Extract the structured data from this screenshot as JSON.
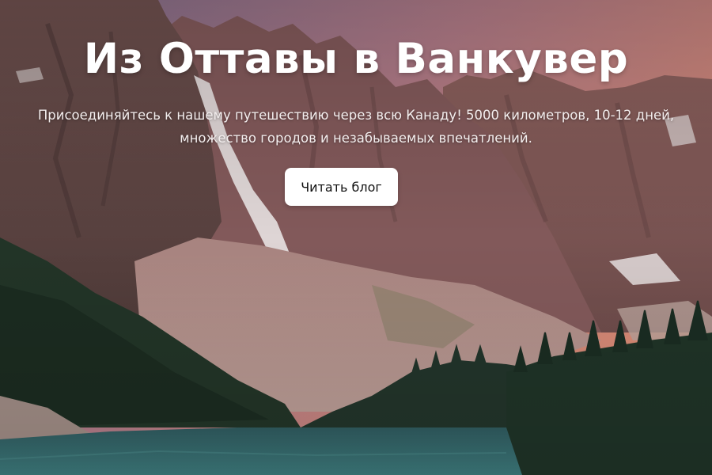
{
  "hero": {
    "title": "Из Оттавы в Ванкувер",
    "subtitle": "Присоединяйтесь к нашему путешествию через всю Канаду! 5000 километров, 10-12 дней, множество городов и незабываемых впечатлений.",
    "button_label": "Читать блог"
  },
  "colors": {
    "button_bg": "#ffffff",
    "button_text": "#111111",
    "title_text": "#ffffff"
  }
}
